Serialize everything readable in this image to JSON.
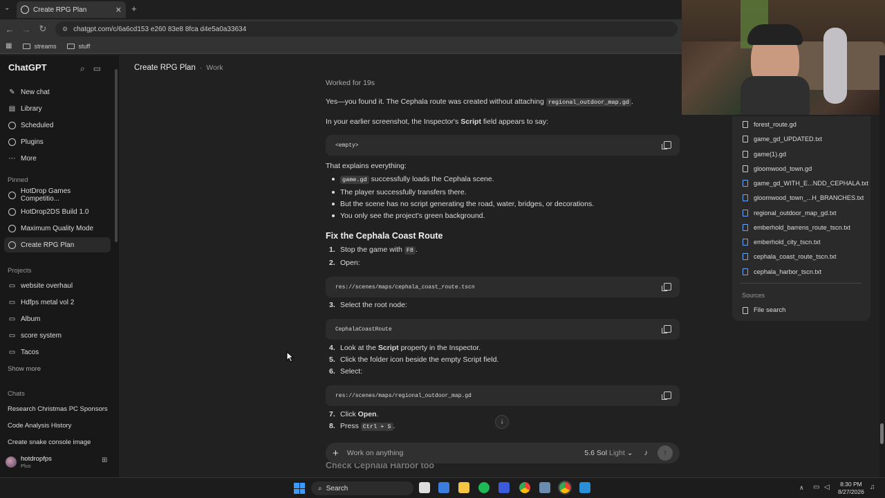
{
  "browser": {
    "tab_title": "Create RPG Plan",
    "url": "chatgpt.com/c/6a6cd153 e260 83e8 8fca d4e5a0a33634",
    "bookmarks": [
      "streams",
      "stuff"
    ]
  },
  "sidebar": {
    "logo": "ChatGPT",
    "nav": [
      "New chat",
      "Library",
      "Scheduled",
      "Plugins",
      "More"
    ],
    "pinned_label": "Pinned",
    "pinned": [
      "HotDrop Games Competitio...",
      "HotDrop2DS Build 1.0",
      "Maximum Quality Mode",
      "Create RPG Plan"
    ],
    "projects_label": "Projects",
    "projects": [
      "website overhaul",
      "Hdfps metal vol 2",
      "Album",
      "score system",
      "Tacos"
    ],
    "show_more": "Show more",
    "chats_label": "Chats",
    "chats": [
      "Research Christmas PC Sponsors",
      "Code Analysis History",
      "Create snake console image"
    ],
    "user": {
      "name": "hotdropfps",
      "plan": "Plus"
    }
  },
  "header": {
    "title": "Create RPG Plan",
    "sep": "·",
    "project": "Work"
  },
  "message": {
    "worked_for": "Worked for 19s",
    "p1_pre": "Yes—you found it. The Cephala route was created without attaching",
    "p1_code": "regional_outdoor_map.gd",
    "p1_post": ".",
    "p2_pre": "In your earlier screenshot, the Inspector's",
    "p2_bold": "Script",
    "p2_post": "field appears to say:",
    "code1": "<empty>",
    "explains": "That explains everything:",
    "bullets": [
      {
        "code": "game.gd",
        "text": "successfully loads the Cephala scene."
      },
      {
        "code": "",
        "text": "The player successfully transfers there."
      },
      {
        "code": "",
        "text": "But the scene has no script generating the road, water, bridges, or decorations."
      },
      {
        "code": "",
        "text": "You only see the project's green background."
      }
    ],
    "heading": "Fix the Cephala Coast Route",
    "step1_pre": "Stop the game with",
    "step1_code": "F8",
    "step1_post": ".",
    "step2": "Open:",
    "code2": "res://scenes/maps/cephala_coast_route.tscn",
    "step3": "Select the root node:",
    "code3": "CephalaCoastRoute",
    "step4_pre": "Look at the",
    "step4_bold": "Script",
    "step4_post": "property in the Inspector.",
    "step5": "Click the folder icon beside the empty Script field.",
    "step6": "Select:",
    "code4": "res://scenes/maps/regional_outdoor_map.gd",
    "step7_pre": "Click",
    "step7_bold": "Open",
    "step7_post": ".",
    "step8_pre": "Press",
    "step8_code": "Ctrl + S",
    "step8_post": ".",
    "next_heading": "Check Cephala Harbor too",
    "nums": [
      "1.",
      "2.",
      "3.",
      "4.",
      "5.",
      "6.",
      "7.",
      "8."
    ]
  },
  "composer": {
    "placeholder": "Work on anything",
    "model": "5.6 Sol",
    "mode": "Light"
  },
  "files_panel": {
    "files": [
      "forest_route.gd",
      "game_gd_UPDATED.txt",
      "game(1).gd",
      "gloomwood_town.gd",
      "game_gd_WITH_E...NDD_CEPHALA.txt",
      "gloomwood_town_...H_BRANCHES.txt",
      "regional_outdoor_map_gd.txt",
      "emberhold_barrens_route_tscn.txt",
      "emberhold_city_tscn.txt",
      "cephala_coast_route_tscn.txt",
      "cephala_harbor_tscn.txt"
    ],
    "sources_label": "Sources",
    "file_search": "File search"
  },
  "taskbar": {
    "search": "Search",
    "time": "8:30 PM",
    "date": "8/27/2026"
  },
  "colors": {
    "accent_blue": "#6aa9ff",
    "bg": "#212121"
  }
}
